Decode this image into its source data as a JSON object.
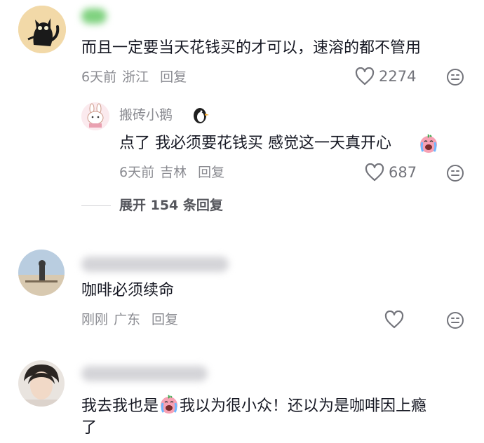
{
  "comments": [
    {
      "text": "而且一定要当天花钱买的才可以，速溶的都不管用",
      "time": "6天前",
      "location": "浙江",
      "reply_label": "回复",
      "likes": "2274"
    },
    {
      "text": "咖啡必须续命",
      "time": "刚刚",
      "location": "广东",
      "reply_label": "回复",
      "likes": ""
    },
    {
      "text_line1a": "我去我也是",
      "text_line1b": "我以为很小众！还以为是咖啡因上瘾",
      "text_line2": "了"
    }
  ],
  "reply": {
    "username": "搬砖小鹅",
    "text": "点了 我必须要花钱买 感觉这一天真开心",
    "time": "6天前",
    "location": "吉林",
    "reply_label": "回复",
    "likes": "687"
  },
  "expand": {
    "label": "展开 154 条回复"
  },
  "icons": {
    "like": "heart-outline-icon",
    "dislike": "neutral-face-icon",
    "cry": "crying-emoji-icon",
    "penguin": "penguin-emoji-icon"
  },
  "colors": {
    "text": "#161823",
    "meta": "#8a8b91",
    "emoji_pink": "#f7a1b4"
  }
}
